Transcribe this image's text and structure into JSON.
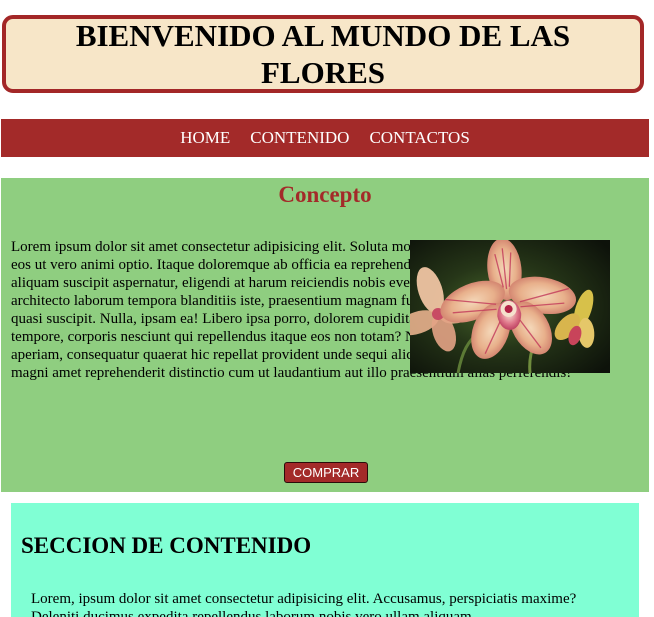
{
  "header": {
    "title": "BIENVENIDO AL MUNDO DE LAS FLORES"
  },
  "nav": {
    "items": [
      "HOME",
      "CONTENIDO",
      "CONTACTOS"
    ]
  },
  "concept": {
    "title": "Concepto",
    "paragraph": "Lorem ipsum dolor sit amet consectetur adipisicing elit. Soluta molestiae facilis perferendis neque, eos ut vero animi optio. Itaque doloremque ab officia ea reprehenderit sit quod eius possimus aliquam suscipit aspernatur, eligendi at harum reiciendis nobis eveniet eligendi accusantium architecto laborum tempora blanditiis iste, praesentium magnam fugiat modi consectetur nobis quasi suscipit. Nulla, ipsam ea! Libero ipsa porro, dolorem cupiditate accusantium placeat ullam tempore, corporis nesciunt qui repellendus itaque eos non totam? Nesciunt facilis reiciendis, aperiam, consequatur quaerat hic repellat provident unde sequi aliquid in rem excepturi odio nemo magni amet reprehenderit distinctio cum ut laudantium aut illo praesentium alias perferendis!",
    "button_label": "COMPRAR"
  },
  "content_section": {
    "title": "SECCION DE CONTENIDO",
    "paragraph": "Lorem, ipsum dolor sit amet consectetur adipisicing elit. Accusamus, perspiciatis maxime? Deleniti ducimus expedita repellendus laborum nobis vero ullam aliquam"
  },
  "colors": {
    "header_bg": "#f7e6c8",
    "accent": "#a32a29",
    "concept_bg": "#8fce80",
    "content_bg": "#80ffd4"
  },
  "icons": {
    "photo": "orchid-photo"
  }
}
